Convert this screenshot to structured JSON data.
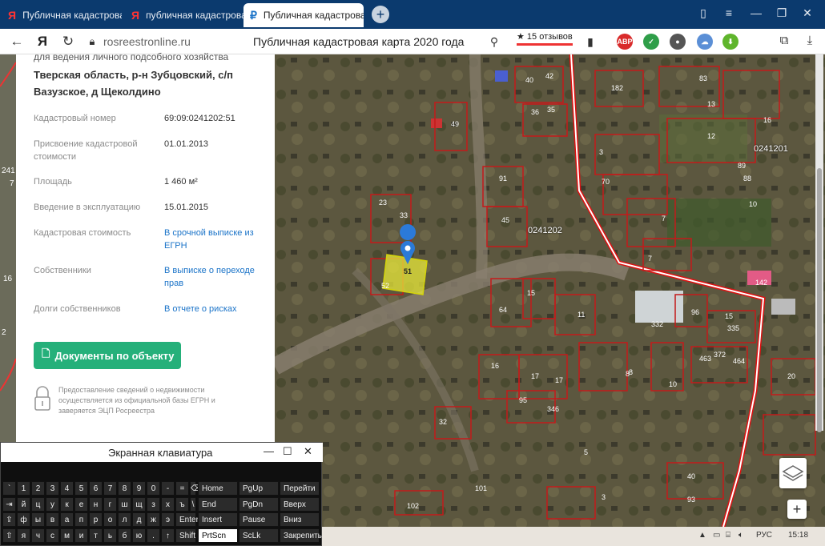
{
  "browser": {
    "tabs": [
      {
        "label": "Публичная кадастровая к",
        "icon": "yandex-icon",
        "active": false
      },
      {
        "label": "публичная кадастровая ка",
        "icon": "yandex-icon",
        "active": false
      },
      {
        "label": "Публичная кадастрова",
        "icon": "rosreestr-icon",
        "active": true,
        "close": "×"
      }
    ],
    "new_tab": "+",
    "url": "rosreestronline.ru",
    "page_title": "Публичная кадастровая карта 2020 года",
    "reviews": "★ 15 отзывов",
    "abp_label": "ABP"
  },
  "panel": {
    "purpose_fragment": "для ведения личного подсобного хозяйства",
    "address_line1": "Тверская область, р-н Зубцовский, с/п",
    "address_line2": "Вазузское, д Щеколдино",
    "rows": [
      {
        "label": "Кадастровый номер",
        "value": "69:09:0241202:51",
        "link": false
      },
      {
        "label": "Присвоение кадастровой стоимости",
        "value": "01.01.2013",
        "link": false
      },
      {
        "label": "Площадь",
        "value": "1 460 м²",
        "link": false
      },
      {
        "label": "Введение в эксплуатацию",
        "value": "15.01.2015",
        "link": false
      },
      {
        "label": "Кадастровая стоимость",
        "value": "В срочной выписке из ЕГРН",
        "link": true
      },
      {
        "label": "Собственники",
        "value": "В выписке о переходе прав",
        "link": true
      },
      {
        "label": "Долги собственников",
        "value": "В отчете о рисках",
        "link": true
      }
    ],
    "doc_button": "Документы по объекту",
    "disclaimer": "Предоставление сведений о недвижимости осуществляется из официальной базы ЕГРН и заверяется ЭЦП Росреестра"
  },
  "map": {
    "block_label": "0241202",
    "block_label_2": "0241201",
    "selected_parcel": "51",
    "left_labels": [
      "241",
      "7",
      "16",
      "2",
      "61",
      "202"
    ],
    "parcels": [
      "40",
      "42",
      "36",
      "35",
      "49",
      "182",
      "83",
      "13",
      "16",
      "12",
      "3",
      "89",
      "88",
      "70",
      "10",
      "91",
      "45",
      "7",
      "23",
      "33",
      "52",
      "7",
      "142",
      "15",
      "64",
      "11",
      "96",
      "335",
      "332",
      "463",
      "372",
      "464",
      "16",
      "17",
      "17",
      "8",
      "10",
      "20",
      "95",
      "346",
      "32",
      "5",
      "40",
      "93",
      "102",
      "101",
      "3",
      "15",
      "8"
    ],
    "zoom_in": "+",
    "layers_icon": "layers-icon"
  },
  "osk": {
    "title": "Экранная клавиатура",
    "min": "—",
    "max": "☐",
    "close": "✕",
    "row1": [
      "`",
      "1",
      "2",
      "3",
      "4",
      "5",
      "6",
      "7",
      "8",
      "9",
      "0",
      "-",
      "=",
      "⌫"
    ],
    "row2": [
      "⇥",
      "й",
      "ц",
      "у",
      "к",
      "е",
      "н",
      "г",
      "ш",
      "щ",
      "з",
      "х",
      "ъ",
      "\\",
      "Del"
    ],
    "row3": [
      "⇪",
      "ф",
      "ы",
      "в",
      "а",
      "п",
      "р",
      "о",
      "л",
      "д",
      "ж",
      "э",
      "Enter"
    ],
    "row4": [
      "⇧",
      "я",
      "ч",
      "с",
      "м",
      "и",
      "т",
      "ь",
      "б",
      "ю",
      ".",
      "↑",
      "Shift"
    ],
    "nav_col1": [
      "Home",
      "End",
      "Insert",
      "PrtScn"
    ],
    "nav_col2": [
      "PgUp",
      "PgDn",
      "Pause",
      "ScLk"
    ],
    "nav_col3": [
      "Перейти",
      "Вверх",
      "Вниз",
      "Закрепить"
    ]
  },
  "taskbar": {
    "lang": "РУС",
    "time": "15:18"
  },
  "colors": {
    "tabbar": "#0b3a6e",
    "accent_green": "#25b07a",
    "link_blue": "#1a73c8",
    "parcel_red": "#c41a1a",
    "selected_parcel_fill": "#e8e83a"
  }
}
